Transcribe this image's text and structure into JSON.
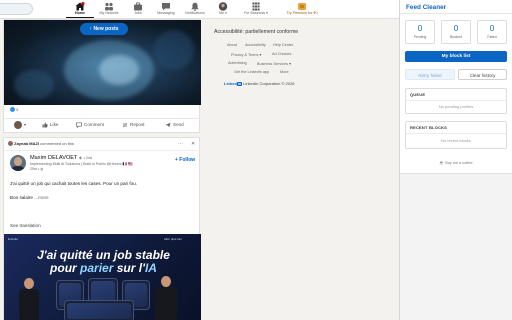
{
  "nav": {
    "items": [
      {
        "label": "Home",
        "icon": "home-icon",
        "active": true
      },
      {
        "label": "My Network",
        "icon": "network-icon"
      },
      {
        "label": "Jobs",
        "icon": "briefcase-icon"
      },
      {
        "label": "Messaging",
        "icon": "messaging-icon"
      },
      {
        "label": "Notifications",
        "icon": "bell-icon"
      },
      {
        "label": "Me ▾",
        "icon": "avatar"
      },
      {
        "label": "For Business ▾",
        "icon": "grid-icon"
      },
      {
        "label": "Try Premium for ₹0",
        "icon": "premium-icon"
      }
    ]
  },
  "feed": {
    "new_posts_label": "New posts",
    "reaction_count": "5",
    "actions": [
      "Like",
      "Comment",
      "Repost",
      "Send"
    ],
    "post2": {
      "commenter_name": "Zaynab MAZI",
      "commenter_action": "commented on this",
      "author_name": "Maxim DELAVOET",
      "author_degree": "• 2nd",
      "author_subtitle": "Implementing Multi AI Solutions | Build in Public @Hexem 🇫🇷 🇺🇸",
      "time": "25m •",
      "follow_label": "+ Follow",
      "text_line1": "J'ai quitté un job qui cachait toutes les cases. Pour un pari fou.",
      "text_line2": "Bon salaire",
      "text_more": "...more",
      "see_translation": "See translation",
      "banner": {
        "line1": "J'ai quitté un job stable",
        "line2_a": "pour ",
        "line2_b": "parier",
        "line2_c": " sur l'",
        "line2_d": "IA",
        "tag_left": "Ensuite",
        "tag_right": "Aller plus loin"
      }
    }
  },
  "middle": {
    "accessibility": "Accessibilité: partiellement conforme",
    "links_row1": [
      "About",
      "Accessibility",
      "Help Center"
    ],
    "links_row2": [
      "Privacy & Terms ▾",
      "Ad Choices"
    ],
    "links_row3": [
      "Advertising",
      "Business Services ▾"
    ],
    "links_row4": [
      "Get the LinkedIn app",
      "More"
    ],
    "footer_brand": "Linked",
    "footer_brand_in": "in",
    "footer_copy": "LinkedIn Corporation © 2026"
  },
  "panel": {
    "title": "Feed Cleaner",
    "stats": [
      {
        "value": "0",
        "label": "Pending"
      },
      {
        "value": "0",
        "label": "Blocked"
      },
      {
        "value": "0",
        "label": "Failed"
      }
    ],
    "my_block_list": "My block list",
    "retry_failed": "Retry failed",
    "clear_history": "Clear history",
    "queue_title": "QUEUE",
    "queue_empty": "No pending profiles",
    "recent_title": "RECENT BLOCKS",
    "recent_empty": "No recent blocks",
    "coffee": "☕ Buy me a coffee"
  },
  "colors": {
    "linkedin_blue": "#0a66c2",
    "premium_gold": "#915907"
  }
}
